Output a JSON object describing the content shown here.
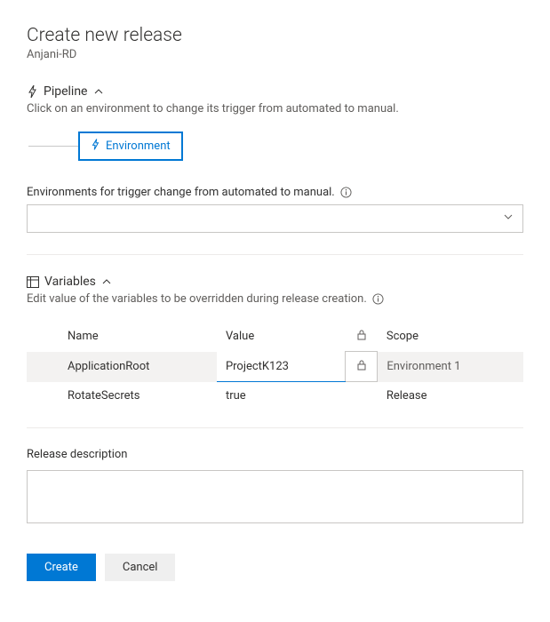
{
  "header": {
    "title": "Create new release",
    "subtitle": "Anjani-RD"
  },
  "pipeline": {
    "section_label": "Pipeline",
    "hint": "Click on an environment to change its trigger from automated to manual.",
    "stage_label": "Environment"
  },
  "env_picker": {
    "label": "Environments for trigger change from automated to manual.",
    "value": ""
  },
  "variables": {
    "section_label": "Variables",
    "hint": "Edit value of the variables to be overridden during release creation.",
    "columns": {
      "name": "Name",
      "value": "Value",
      "scope": "Scope"
    },
    "rows": [
      {
        "name": "ApplicationRoot",
        "value": "ProjectK123",
        "locked": false,
        "scope": "Environment 1",
        "active": true
      },
      {
        "name": "RotateSecrets",
        "value": "true",
        "locked": false,
        "scope": "Release",
        "active": false
      }
    ]
  },
  "description": {
    "label": "Release description",
    "value": ""
  },
  "buttons": {
    "create": "Create",
    "cancel": "Cancel"
  }
}
